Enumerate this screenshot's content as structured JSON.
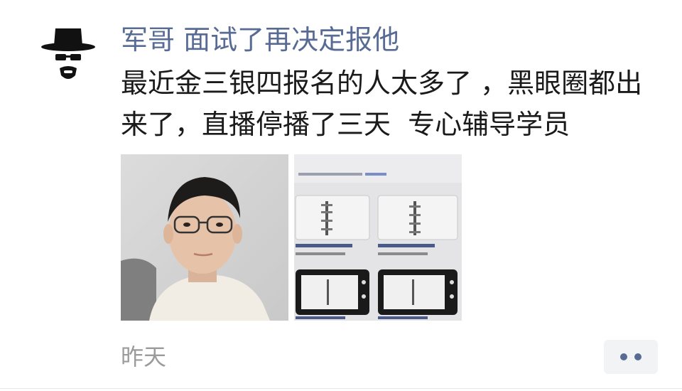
{
  "post": {
    "author": "军哥 面试了再决定报他",
    "text": "最近金三银四报名的人太多了 ，黑眼圈都出来了，直播停播了三天  专心辅导学员",
    "time": "昨天",
    "avatar_icon": "heisenberg-avatar-icon",
    "more_icon": "more-dots-icon",
    "photos": [
      {
        "name": "selfie-photo"
      },
      {
        "name": "screen-photo"
      }
    ]
  }
}
